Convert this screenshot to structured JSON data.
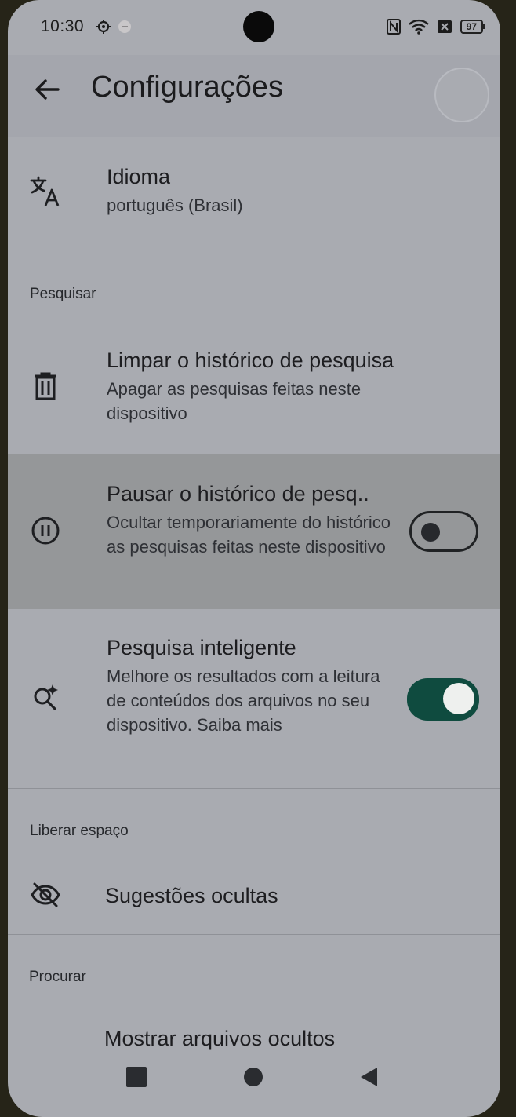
{
  "status_bar": {
    "time": "10:30",
    "battery": "97",
    "icons": [
      "settings-gear-icon",
      "minus-badge-icon",
      "nfc-icon",
      "wifi-icon",
      "sim-off-icon",
      "battery-icon"
    ]
  },
  "header": {
    "title": "Configurações"
  },
  "language": {
    "label": "Idioma",
    "value": "português (Brasil)"
  },
  "sections": {
    "search": "Pesquisar",
    "free_space": "Liberar espaço",
    "browse": "Procurar"
  },
  "clear_history": {
    "title": "Limpar o histórico de pesquisa",
    "subtitle": "Apagar as pesquisas feitas neste dispositivo"
  },
  "pause_history": {
    "title": "Pausar o histórico de pesq..",
    "subtitle": "Ocultar temporariamente do histórico as pesquisas feitas neste dispositivo",
    "enabled": false
  },
  "smart_search": {
    "title": "Pesquisa inteligente",
    "subtitle": "Melhore os resultados com a leitura de conteúdos dos arquivos no seu dispositivo.",
    "link": "Saiba mais",
    "enabled": true
  },
  "hidden_suggestions": {
    "title": "Sugestões ocultas"
  },
  "show_hidden_files": {
    "title": "Mostrar arquivos ocultos"
  },
  "colors": {
    "accent": "#0f4b3f",
    "background": "#a9abb1",
    "highlight": "#959799"
  }
}
